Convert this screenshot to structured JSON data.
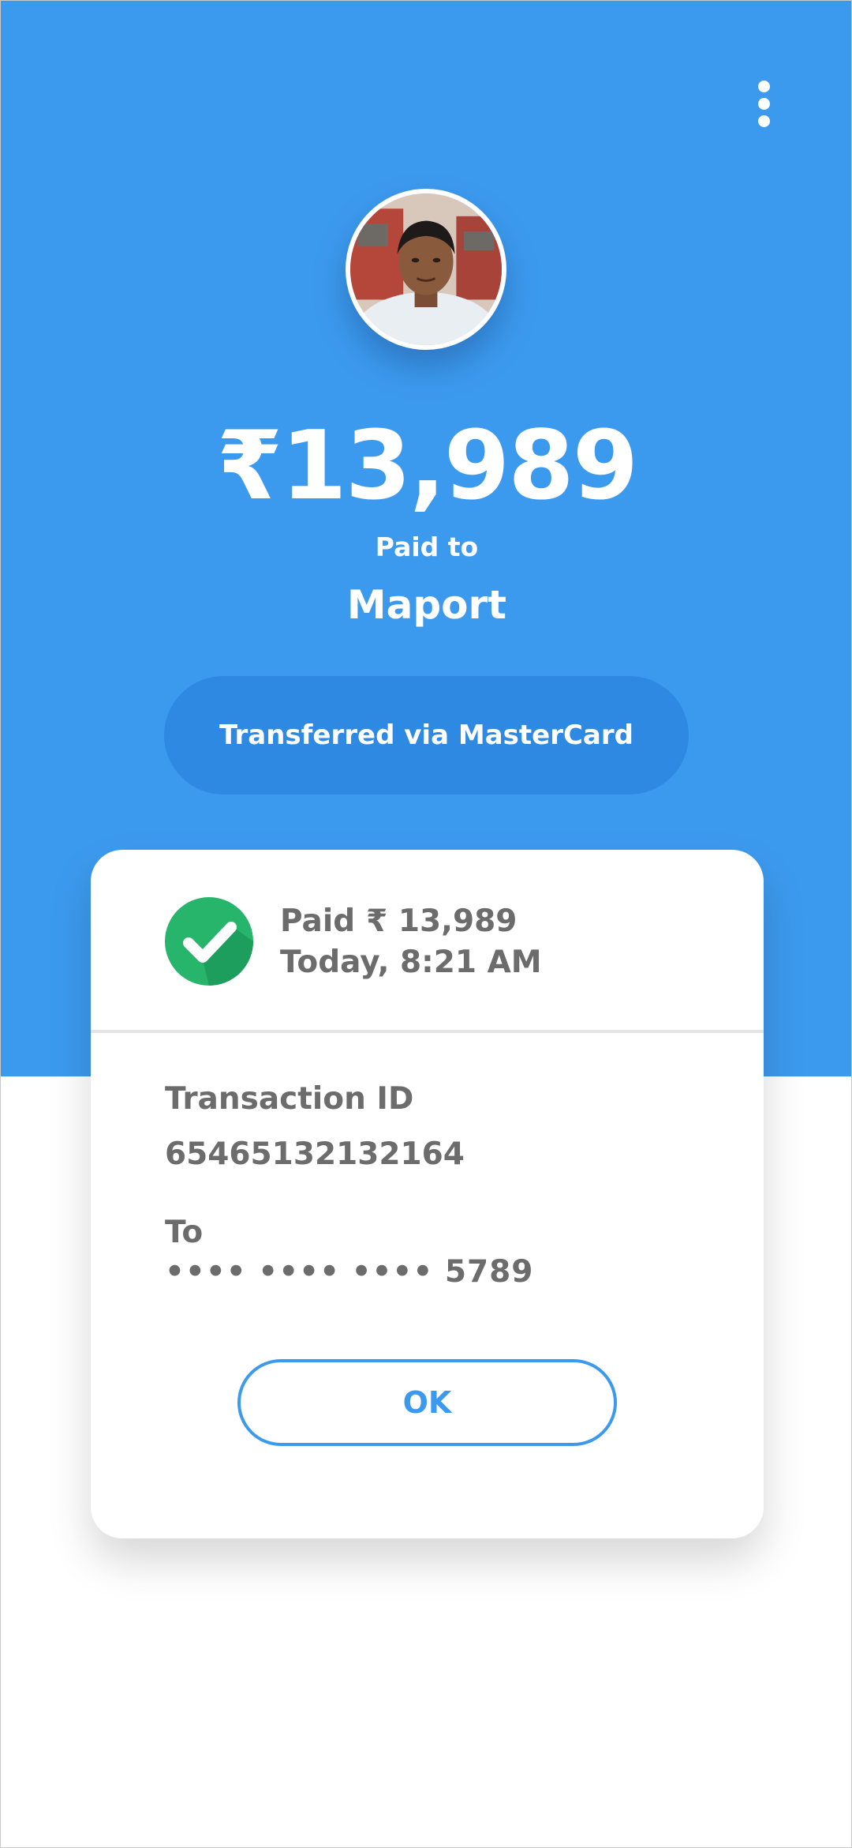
{
  "header": {
    "menu_icon": "more-vertical-icon",
    "avatar_alt": "payee-photo"
  },
  "payment": {
    "amount": "₹13,989",
    "paid_to_label": "Paid to",
    "payee_name": "Maport",
    "method_text": "Transferred via MasterCard"
  },
  "receipt": {
    "status_icon": "check-circle-icon",
    "status_word": "Paid",
    "status_amount": "₹ 13,989",
    "timestamp": "Today, 8:21 AM",
    "transaction_id_label": "Transaction ID",
    "transaction_id": "65465132132164",
    "to_label": "To",
    "to_card": "•••• •••• •••• 5789",
    "ok_label": "OK"
  },
  "colors": {
    "primary": "#3c9aee",
    "pill": "#2d89e1",
    "success": "#27b56b",
    "text_gray": "#6c6c6c"
  }
}
